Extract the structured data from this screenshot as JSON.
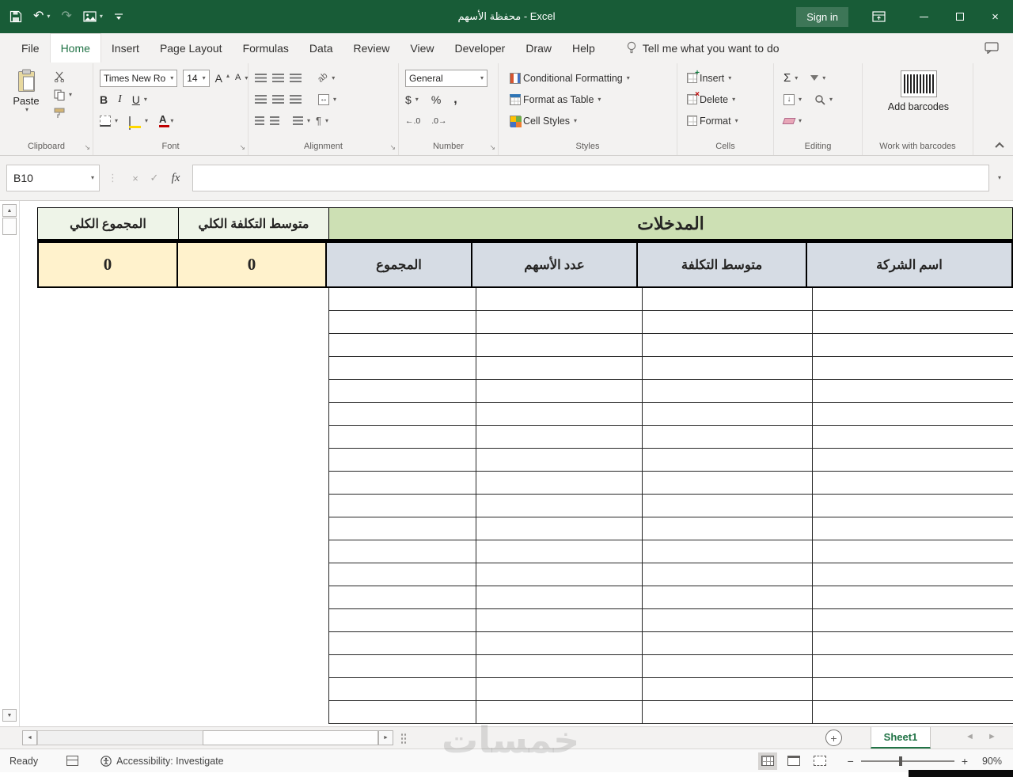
{
  "titlebar": {
    "title": "محفظة الأسهم  -  Excel",
    "sign_in": "Sign in"
  },
  "tabs": {
    "items": [
      {
        "label": "File"
      },
      {
        "label": "Home"
      },
      {
        "label": "Insert"
      },
      {
        "label": "Page Layout"
      },
      {
        "label": "Formulas"
      },
      {
        "label": "Data"
      },
      {
        "label": "Review"
      },
      {
        "label": "View"
      },
      {
        "label": "Developer"
      },
      {
        "label": "Draw"
      },
      {
        "label": "Help"
      }
    ],
    "tell_me": "Tell me what you want to do"
  },
  "ribbon": {
    "clipboard": {
      "paste": "Paste",
      "label": "Clipboard"
    },
    "font": {
      "name": "Times New Ro",
      "size": "14",
      "label": "Font"
    },
    "alignment": {
      "label": "Alignment"
    },
    "number": {
      "format": "General",
      "label": "Number"
    },
    "styles": {
      "conditional": "Conditional Formatting",
      "format_table": "Format as Table",
      "cell_styles": "Cell Styles",
      "label": "Styles"
    },
    "cells": {
      "insert": "Insert",
      "delete": "Delete",
      "format": "Format",
      "label": "Cells"
    },
    "editing": {
      "label": "Editing"
    },
    "barcodes": {
      "button": "Add barcodes",
      "label": "Work with barcodes"
    }
  },
  "formula_bar": {
    "name_box": "B10",
    "fx": "fx",
    "value": ""
  },
  "sheet": {
    "inputs_header": "المدخلات",
    "grand_total_header": "المجموع الكلي",
    "grand_avg_cost_header": "متوسط التكلفة الكلي",
    "grand_total_value": "0",
    "grand_avg_cost_value": "0",
    "columns": [
      "المجموع",
      "عدد الأسهم",
      "متوسط التكلفة",
      "اسم الشركة"
    ],
    "empty_row_count": 19
  },
  "sheet_tabs": {
    "active": "Sheet1"
  },
  "watermark": "خمسات",
  "status_bar": {
    "ready": "Ready",
    "accessibility": "Accessibility: Investigate",
    "zoom_level": "90%"
  },
  "colors": {
    "titlebar_green": "#185C37",
    "accent_green": "#217346",
    "inputs_header_green": "#CDE0B4",
    "subheader_green": "#EEF4E8",
    "value_yellow": "#FFF2CC",
    "column_header_blue": "#D6DCE4"
  },
  "icons": {
    "undo": "↶",
    "redo": "↷",
    "chevron_down": "▾",
    "triangle_up": "▴",
    "close": "×",
    "cancel": "×",
    "check": "✓",
    "dots": "⋮",
    "sum": "Σ",
    "dollar": "$",
    "percent": "%",
    "comma": ",",
    "bold": "B",
    "italic": "I",
    "underline": "U",
    "font_letter": "A",
    "increase_decimal": "←.0",
    "decrease_decimal": ".0→",
    "fill_down": "↓",
    "merge": "↔",
    "orientation": "ab",
    "paragraph": "¶",
    "dialog_launcher": "↘",
    "scroll_up": "▲",
    "scroll_down": "▼",
    "scroll_left": "◄",
    "scroll_right": "►",
    "nav_prev": "◄",
    "nav_next": "►",
    "new_sheet": "+",
    "zoom_out": "−",
    "zoom_in": "+"
  }
}
